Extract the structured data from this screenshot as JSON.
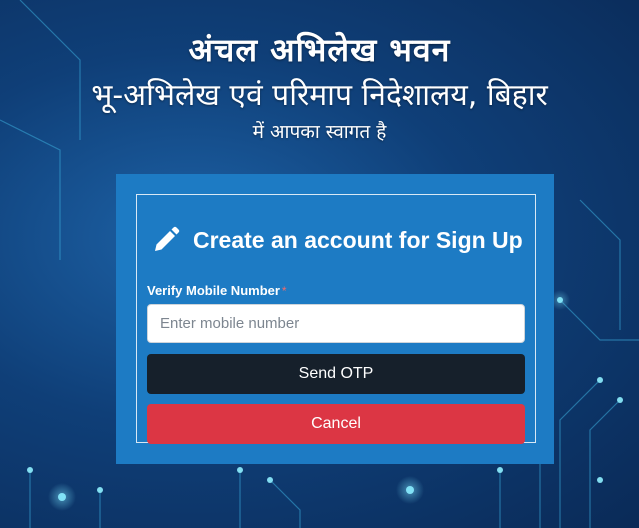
{
  "header": {
    "title": "अंचल अभिलेख भवन",
    "subtitle": "भू-अभिलेख एवं परिमाप निदेशालय, बिहार",
    "welcome": "में आपका स्वागत है"
  },
  "signup_card": {
    "heading": "Create an account for Sign Up",
    "heading_icon": "pencil-icon",
    "mobile_label": "Verify Mobile Number",
    "required_marker": "*",
    "mobile_placeholder": "Enter mobile number",
    "mobile_value": "",
    "send_otp_label": "Send OTP",
    "cancel_label": "Cancel"
  },
  "colors": {
    "card_background": "#1d7bc4",
    "send_otp_button": "#16202b",
    "cancel_button": "#dc3644",
    "page_background": "#0f3f78"
  }
}
